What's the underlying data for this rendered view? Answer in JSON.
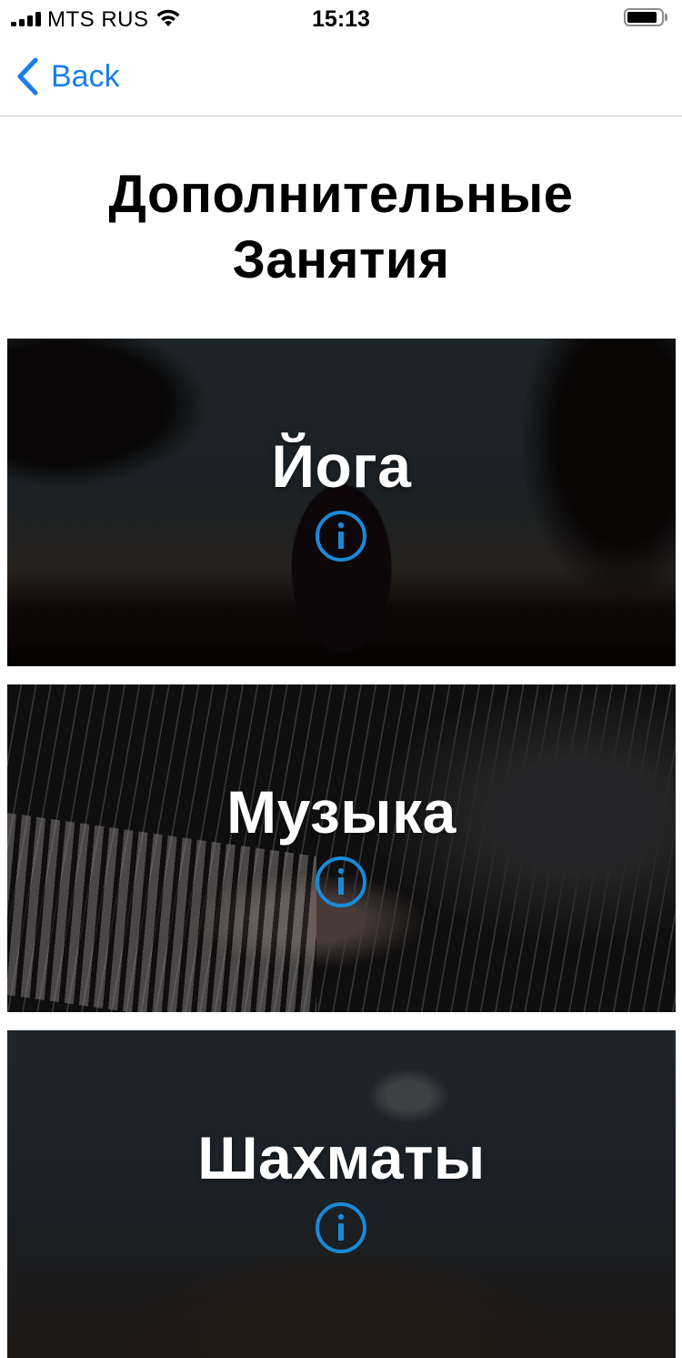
{
  "status_bar": {
    "carrier": "MTS RUS",
    "time": "15:13"
  },
  "nav": {
    "back_label": "Back"
  },
  "page": {
    "title_line1": "Дополнительные",
    "title_line2": "Занятия"
  },
  "activities": [
    {
      "title": "Йога",
      "icon": "info-icon"
    },
    {
      "title": "Музыка",
      "icon": "info-icon"
    },
    {
      "title": "Шахматы",
      "icon": "info-icon"
    }
  ],
  "colors": {
    "accent": "#1a7ee8",
    "info_icon": "#1a8ad8",
    "card_title": "#ffffff"
  }
}
